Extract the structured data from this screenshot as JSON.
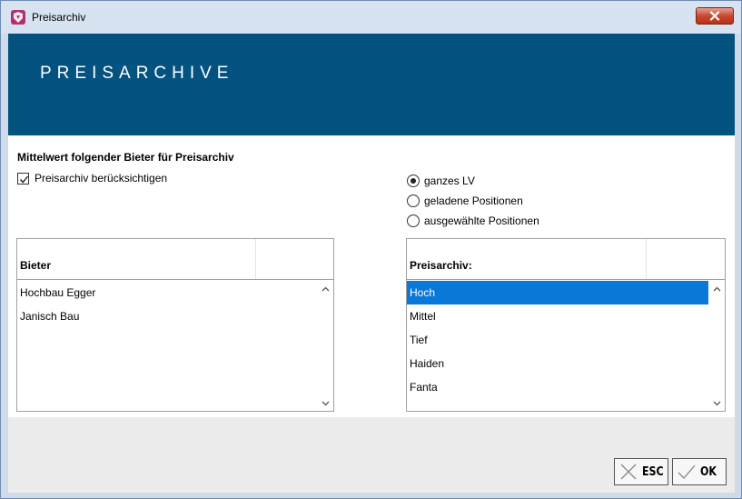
{
  "window": {
    "title": "Preisarchiv",
    "header_title": "PREISARCHIVE"
  },
  "form": {
    "section_title": "Mittelwert folgender Bieter für Preisarchiv",
    "checkbox_label": "Preisarchiv berücksichtigen",
    "checkbox_checked": true,
    "radio_options": [
      {
        "label": "ganzes LV",
        "checked": true
      },
      {
        "label": "geladene Positionen",
        "checked": false
      },
      {
        "label": "ausgewählte Positionen",
        "checked": false
      }
    ]
  },
  "bieter_list": {
    "header": "Bieter",
    "rows": [
      "Hochbau Egger",
      "Janisch Bau"
    ]
  },
  "archive_list": {
    "header": "Preisarchiv:",
    "rows": [
      "Hoch",
      "Mittel",
      "Tief",
      "Haiden",
      "Fanta"
    ],
    "selected_index": 0
  },
  "buttons": {
    "esc_label": "ESC",
    "ok_label": "OK"
  },
  "icons": {
    "app": "app-logo-icon",
    "close": "close-icon",
    "check": "checkmark-icon",
    "esc": "x-mark-icon",
    "ok": "checkmark-icon"
  },
  "colors": {
    "header_bg": "#03527f",
    "selection": "#0a78d7",
    "close_button": "#c8482f"
  }
}
